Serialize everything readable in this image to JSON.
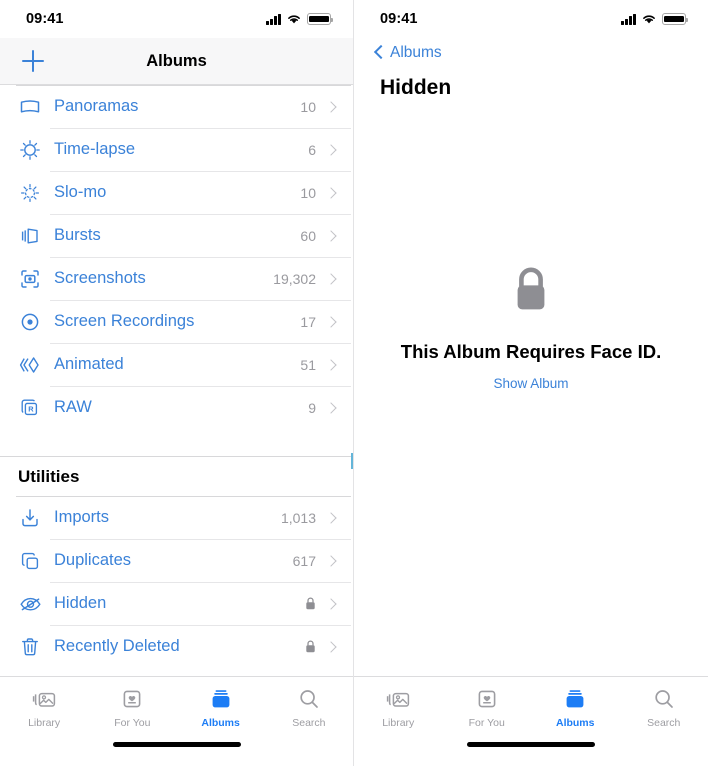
{
  "status": {
    "time": "09:41",
    "cellular_icon": "cellular-bars-icon",
    "wifi_icon": "wifi-icon",
    "battery_icon": "battery-full-icon"
  },
  "colors": {
    "link_blue": "#3b82d8",
    "tab_active_blue": "#1d7df5",
    "count_gray": "#9a9a9f",
    "lock_gray": "#8e8e93",
    "navbar_bg": "#f7f7f8"
  },
  "left_screen": {
    "nav": {
      "add_label": "+",
      "add_icon": "plus-icon",
      "title": "Albums"
    },
    "media_types": [
      {
        "label": "Panoramas",
        "count": "10",
        "icon": "panorama-icon"
      },
      {
        "label": "Time-lapse",
        "count": "6",
        "icon": "timelapse-icon"
      },
      {
        "label": "Slo-mo",
        "count": "10",
        "icon": "slomo-icon"
      },
      {
        "label": "Bursts",
        "count": "60",
        "icon": "bursts-icon"
      },
      {
        "label": "Screenshots",
        "count": "19,302",
        "icon": "screenshot-icon"
      },
      {
        "label": "Screen Recordings",
        "count": "17",
        "icon": "screen-recording-icon"
      },
      {
        "label": "Animated",
        "count": "51",
        "icon": "animated-icon"
      },
      {
        "label": "RAW",
        "count": "9",
        "icon": "raw-icon"
      }
    ],
    "utilities": {
      "header": "Utilities",
      "items": [
        {
          "label": "Imports",
          "count": "1,013",
          "locked": false,
          "icon": "import-icon"
        },
        {
          "label": "Duplicates",
          "count": "617",
          "locked": false,
          "icon": "duplicates-icon"
        },
        {
          "label": "Hidden",
          "count": "",
          "locked": true,
          "icon": "hidden-eye-icon"
        },
        {
          "label": "Recently Deleted",
          "count": "",
          "locked": true,
          "icon": "trash-icon"
        }
      ]
    }
  },
  "right_screen": {
    "nav": {
      "back_label": "Albums",
      "back_icon": "chevron-left-icon",
      "title": "Hidden"
    },
    "empty_state": {
      "icon": "lock-icon",
      "title": "This Album Requires Face ID.",
      "action": "Show Album"
    }
  },
  "tabbar": {
    "tabs": [
      {
        "label": "Library",
        "icon": "library-icon",
        "active": false
      },
      {
        "label": "For You",
        "icon": "for-you-icon",
        "active": false
      },
      {
        "label": "Albums",
        "icon": "albums-icon",
        "active": true
      },
      {
        "label": "Search",
        "icon": "search-icon",
        "active": false
      }
    ]
  }
}
